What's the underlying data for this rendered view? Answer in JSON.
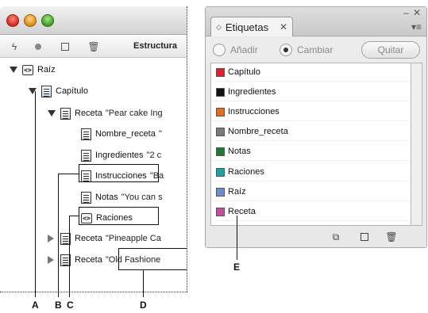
{
  "structure_pane": {
    "toolbar": {
      "label": "Estructura"
    },
    "tree": [
      {
        "label": "Raíz",
        "fragment": ""
      },
      {
        "label": "Capítulo",
        "fragment": ""
      },
      {
        "label": "Receta",
        "fragment": "\"Pear cake Ing"
      },
      {
        "label": "Nombre_receta",
        "fragment": "\""
      },
      {
        "label": "Ingredientes",
        "fragment": "\"2 c"
      },
      {
        "label": "Instrucciones",
        "fragment": "\"Ba"
      },
      {
        "label": "Notas",
        "fragment": "\"You can s"
      },
      {
        "label": "Raciones",
        "fragment": ""
      },
      {
        "label": "Receta",
        "fragment": "\"Pineapple Ca"
      },
      {
        "label": "Receta",
        "fragment": "\"Old Fashione"
      }
    ]
  },
  "callouts": {
    "a": "A",
    "b": "B",
    "c": "C",
    "d": "D",
    "e": "E"
  },
  "tags_panel": {
    "tab_label": "Etiquetas",
    "add_label": "Añadir",
    "change_label": "Cambiar",
    "remove_label": "Quitar",
    "items": [
      {
        "name": "Capítulo",
        "color": "#e0202a"
      },
      {
        "name": "Ingredientes",
        "color": "#111111"
      },
      {
        "name": "Instrucciones",
        "color": "#e86a1c"
      },
      {
        "name": "Nombre_receta",
        "color": "#7a7a7a"
      },
      {
        "name": "Notas",
        "color": "#1f7a3a"
      },
      {
        "name": "Raciones",
        "color": "#1aa3a6"
      },
      {
        "name": "Raíz",
        "color": "#6a8fd0"
      },
      {
        "name": "Receta",
        "color": "#c4509a"
      }
    ]
  }
}
